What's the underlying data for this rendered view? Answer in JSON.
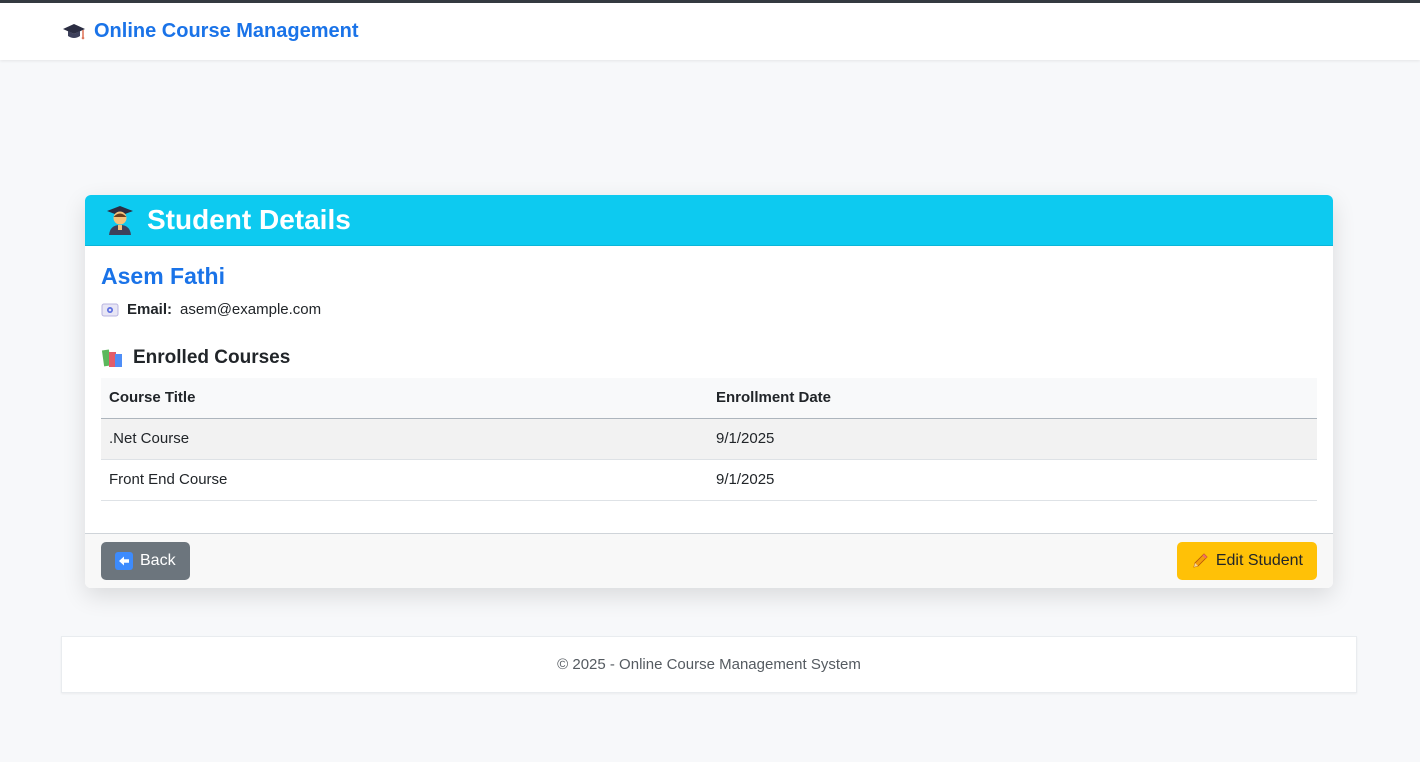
{
  "navbar": {
    "brand_icon": "graduation-cap-icon",
    "brand_text": "Online Course Management"
  },
  "card": {
    "header_icon": "student-icon",
    "header_title": "Student Details",
    "student_name": "Asem Fathi",
    "email_icon": "email-icon",
    "email_label": "Email:",
    "email_value": "asem@example.com",
    "courses_icon": "books-icon",
    "courses_title": "Enrolled Courses",
    "table": {
      "headers": [
        "Course Title",
        "Enrollment Date"
      ],
      "rows": [
        [
          ".Net Course",
          "9/1/2025"
        ],
        [
          "Front End Course",
          "9/1/2025"
        ]
      ]
    },
    "back_button": {
      "icon": "back-arrow-icon",
      "label": "Back"
    },
    "edit_button": {
      "icon": "pencil-icon",
      "label": "Edit Student"
    }
  },
  "footer": {
    "text": "© 2025 - Online Course Management System"
  },
  "colors": {
    "brand": "#1a73e8",
    "header_bg": "#0dcaf0",
    "back_btn": "#6c757d",
    "edit_btn": "#ffc107"
  }
}
